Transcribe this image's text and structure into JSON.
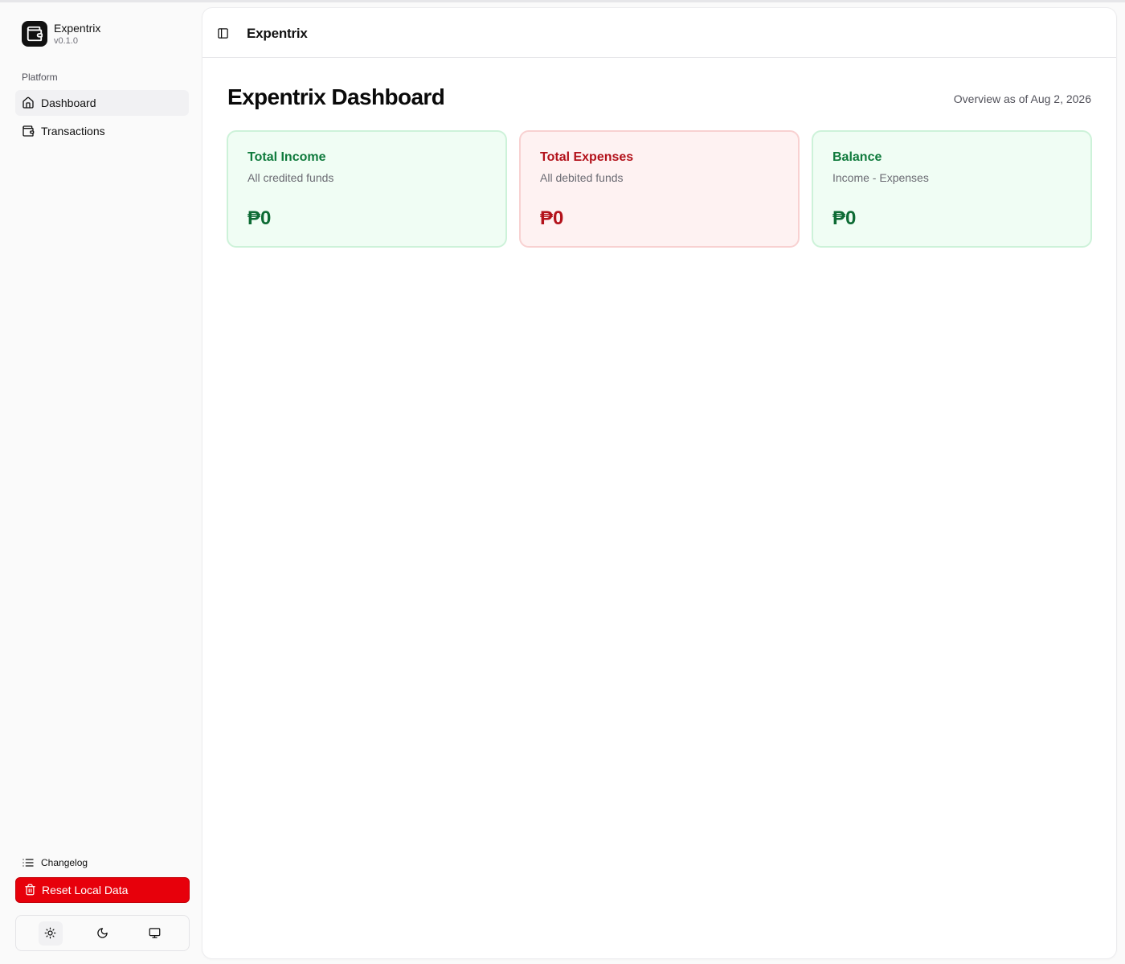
{
  "app": {
    "name": "Expentrix",
    "version": "v0.1.0"
  },
  "sidebar": {
    "group_label": "Platform",
    "items": [
      {
        "label": "Dashboard",
        "icon": "home-icon",
        "active": true
      },
      {
        "label": "Transactions",
        "icon": "wallet-icon",
        "active": false
      }
    ],
    "changelog_label": "Changelog",
    "reset_label": "Reset Local Data",
    "theme_options": [
      {
        "name": "light",
        "icon": "sun-icon",
        "active": true
      },
      {
        "name": "dark",
        "icon": "moon-icon",
        "active": false
      },
      {
        "name": "system",
        "icon": "monitor-icon",
        "active": false
      }
    ]
  },
  "header": {
    "title": "Expentrix"
  },
  "main": {
    "page_title": "Expentrix Dashboard",
    "overview_text": "Overview as of Aug 2, 2026",
    "cards": [
      {
        "title": "Total Income",
        "subtitle": "All credited funds",
        "value": "₱0",
        "tone": "green"
      },
      {
        "title": "Total Expenses",
        "subtitle": "All debited funds",
        "value": "₱0",
        "tone": "red"
      },
      {
        "title": "Balance",
        "subtitle": "Income - Expenses",
        "value": "₱0",
        "tone": "green"
      }
    ]
  },
  "colors": {
    "reset_button": "#e7000b",
    "income": "#0f7a3c",
    "expense": "#b3121b"
  }
}
